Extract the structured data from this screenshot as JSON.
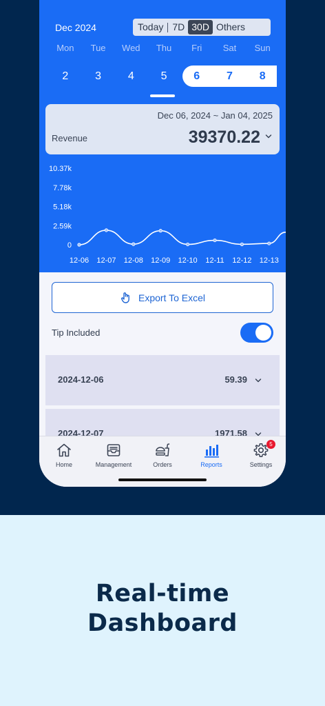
{
  "header": {
    "month": "Dec 2024",
    "range_options": [
      {
        "label": "Today",
        "active": false
      },
      {
        "label": "7D",
        "active": false
      },
      {
        "label": "30D",
        "active": true
      },
      {
        "label": "Others",
        "active": false
      }
    ]
  },
  "calendar": {
    "weekdays": [
      "Mon",
      "Tue",
      "Wed",
      "Thu",
      "Fri",
      "Sat",
      "Sun"
    ],
    "days": [
      {
        "label": "2",
        "selected": false
      },
      {
        "label": "3",
        "selected": false
      },
      {
        "label": "4",
        "selected": false
      },
      {
        "label": "5",
        "selected": false
      },
      {
        "label": "6",
        "selected": true
      },
      {
        "label": "7",
        "selected": true
      },
      {
        "label": "8",
        "selected": true
      }
    ]
  },
  "revenue_card": {
    "date_range": "Dec 06, 2024 ~ Jan 04, 2025",
    "label": "Revenue",
    "value": "39370.22"
  },
  "chart_data": {
    "type": "line",
    "x": [
      "12-06",
      "12-07",
      "12-08",
      "12-09",
      "12-10",
      "12-11",
      "12-12",
      "12-13"
    ],
    "values": [
      0,
      1971.58,
      80,
      1900,
      50,
      600,
      60,
      180
    ],
    "y_ticks": [
      "10.37k",
      "7.78k",
      "5.18k",
      "2.59k",
      "0"
    ],
    "ylim": [
      0,
      10370
    ],
    "grid": false,
    "line_color": "#ffffff"
  },
  "actions": {
    "export_label": "Export To Excel",
    "tip_label": "Tip Included",
    "tip_on": true
  },
  "rows": [
    {
      "date": "2024-12-06",
      "amount": "59.39"
    },
    {
      "date": "2024-12-07",
      "amount": "1971.58"
    }
  ],
  "tabbar": {
    "items": [
      {
        "label": "Home",
        "icon": "home-icon",
        "active": false
      },
      {
        "label": "Management",
        "icon": "inbox-icon",
        "active": false
      },
      {
        "label": "Orders",
        "icon": "food-icon",
        "active": false
      },
      {
        "label": "Reports",
        "icon": "bar-chart-icon",
        "active": true
      },
      {
        "label": "Settings",
        "icon": "gear-icon",
        "active": false,
        "badge": "5"
      }
    ]
  },
  "promo": {
    "line1": "Real-time",
    "line2": "Dashboard"
  },
  "colors": {
    "brand_blue": "#1a6cf5",
    "navy": "#01264e",
    "badge_red": "#e8192f"
  }
}
